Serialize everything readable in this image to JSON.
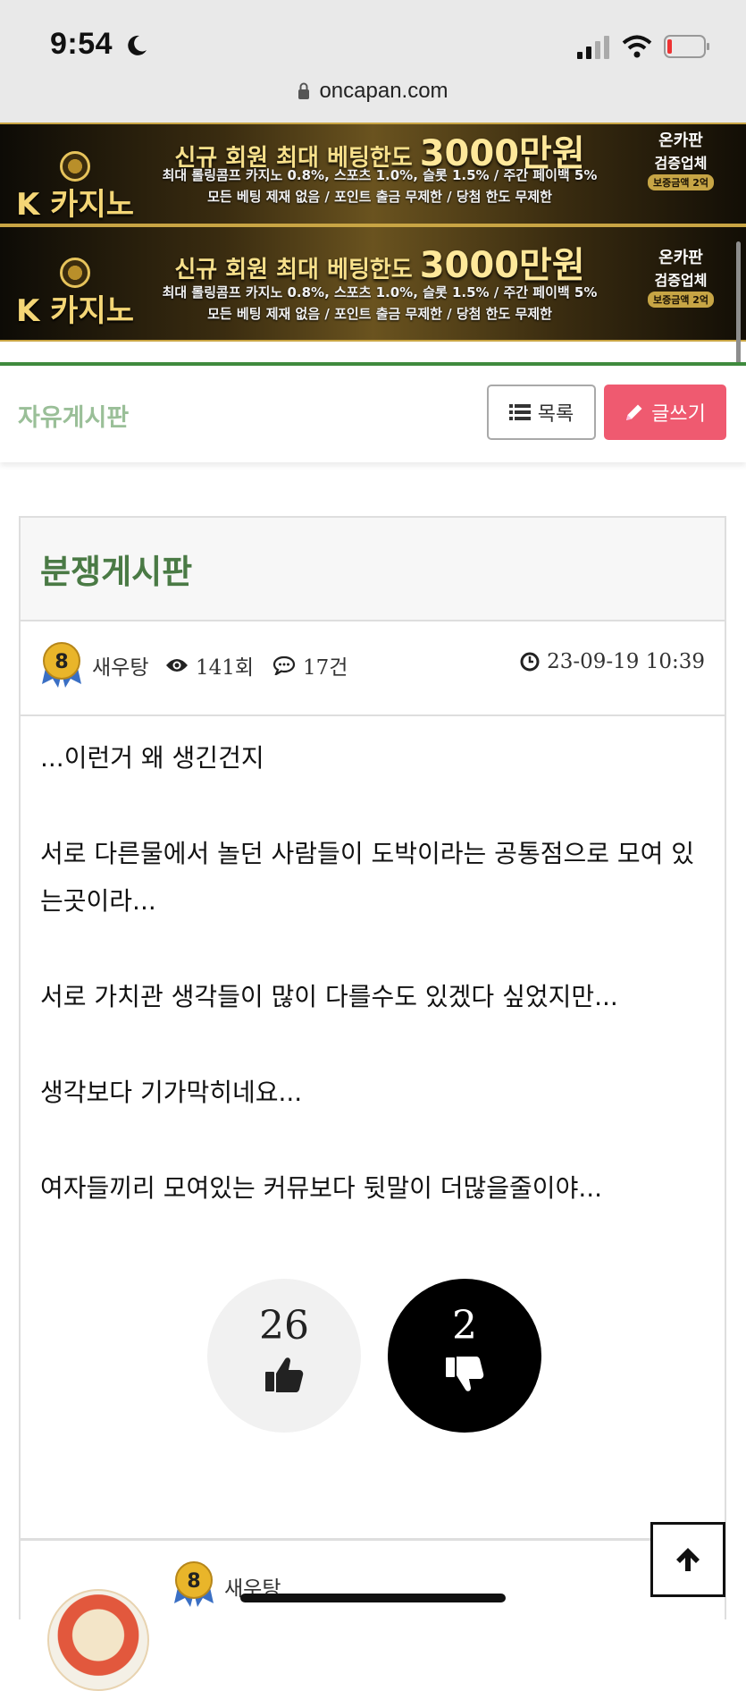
{
  "status_bar": {
    "time": "9:54",
    "url": "oncapan.com"
  },
  "banners": [
    {
      "logo": "K 카지노",
      "headline": "신규 회원 최대 베팅한도",
      "headline_big": "3000만원",
      "line1": "최대 롤링콤프 카지노 0.8%, 스포츠 1.0%, 슬롯 1.5% / 주간 페이백 5%",
      "line2": "모든 베팅 제재 없음 / 포인트 출금 무제한 / 당첨 한도 무제한",
      "seal1": "온카판",
      "seal2": "검증업체",
      "seal3": "보증금액 2억"
    },
    {
      "logo": "K 카지노",
      "headline": "신규 회원 최대 베팅한도",
      "headline_big": "3000만원",
      "line1": "최대 롤링콤프 카지노 0.8%, 스포츠 1.0%, 슬롯 1.5% / 주간 페이백 5%",
      "line2": "모든 베팅 제재 없음 / 포인트 출금 무제한 / 당첨 한도 무제한",
      "seal1": "온카판",
      "seal2": "검증업체",
      "seal3": "보증금액 2억"
    }
  ],
  "board": {
    "name": "자유게시판",
    "list_label": "목록",
    "write_label": "글쓰기"
  },
  "post": {
    "title": "분쟁게시판",
    "author": "새우탕",
    "level": "8",
    "views": "141회",
    "comments": "17건",
    "datetime": "23-09-19 10:39",
    "paragraphs": [
      "...이런거 왜 생긴건지",
      "서로 다른물에서 놀던 사람들이  도박이라는 공통점으로 모여 있는곳이라...",
      "서로 가치관 생각들이 많이 다를수도 있겠다 싶었지만...",
      "생각보다 기가막히네요...",
      "여자들끼리 모여있는 커뮤보다 뒷말이 더많을줄이야..."
    ],
    "likes": "26",
    "dislikes": "2"
  },
  "comment_preview": {
    "author": "새우탕",
    "level": "8"
  },
  "colors": {
    "accent_green": "#3f8a3d",
    "title_green": "#4a7a45",
    "write_button": "#ef5a70"
  }
}
